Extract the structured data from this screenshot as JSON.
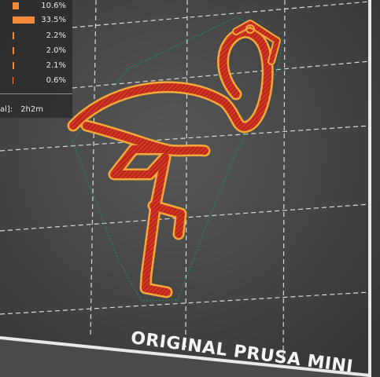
{
  "legend": {
    "items": [
      {
        "percent": "10.6%",
        "fraction": 0.106
      },
      {
        "percent": "33.5%",
        "fraction": 0.335
      },
      {
        "percent": "2.2%",
        "fraction": 0.022
      },
      {
        "percent": "2.0%",
        "fraction": 0.02
      },
      {
        "percent": "2.1%",
        "fraction": 0.021
      },
      {
        "percent": "0.6%",
        "fraction": 0.006
      }
    ],
    "time_label": "al]:",
    "time_value": "2h2m"
  },
  "bed": {
    "label": "ORIGINAL PRUSA MINI"
  },
  "colors": {
    "background": "#4a4a4a",
    "bed_surface": "#3c3c3c",
    "grid_line": "#d8d8d8",
    "bed_frame": "#ececec",
    "print_fill": "#c0261b",
    "print_perimeter": "#f2a83a",
    "skirt": "#1f8a6a",
    "legend_bar": "#f5893a"
  }
}
